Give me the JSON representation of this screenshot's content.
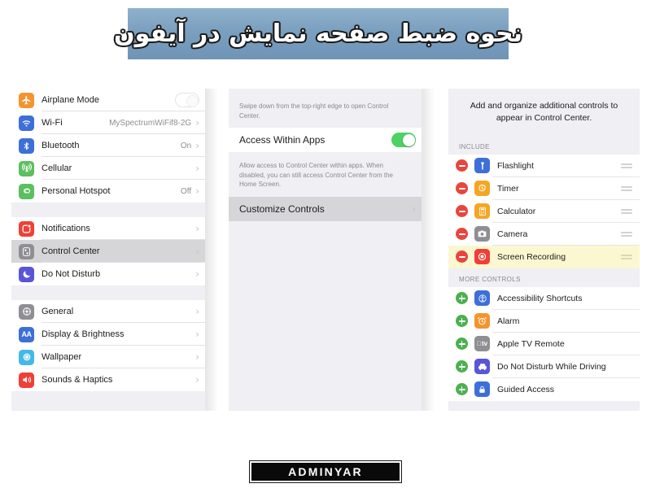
{
  "banner": {
    "title": "نحوه ضبط صفحه نمایش در آیفون",
    "bg_color": "#7a9fbf",
    "text_color": "#ffffff"
  },
  "settings_panel": {
    "groups": [
      {
        "rows": [
          {
            "label": "Airplane Mode",
            "value": "",
            "icon": "airplane-icon",
            "icon_color": "#f5942e",
            "accessory": "toggle",
            "toggle_state": "off"
          },
          {
            "label": "Wi-Fi",
            "value": "MySpectrumWiFif8-2G",
            "icon": "wifi-icon",
            "icon_color": "#3d6fd8",
            "accessory": "chevron"
          },
          {
            "label": "Bluetooth",
            "value": "On",
            "icon": "bluetooth-icon",
            "icon_color": "#3d6fd8",
            "accessory": "chevron"
          },
          {
            "label": "Cellular",
            "value": "",
            "icon": "cellular-icon",
            "icon_color": "#5bc05f",
            "accessory": "chevron"
          },
          {
            "label": "Personal Hotspot",
            "value": "Off",
            "icon": "hotspot-icon",
            "icon_color": "#5bc05f",
            "accessory": "chevron"
          }
        ]
      },
      {
        "rows": [
          {
            "label": "Notifications",
            "value": "",
            "icon": "notifications-icon",
            "icon_color": "#f03f36",
            "accessory": "chevron"
          },
          {
            "label": "Control Center",
            "value": "",
            "icon": "control-center-icon",
            "icon_color": "#8e8e93",
            "accessory": "chevron",
            "selected": true
          },
          {
            "label": "Do Not Disturb",
            "value": "",
            "icon": "moon-icon",
            "icon_color": "#5a55d8",
            "accessory": "chevron"
          }
        ]
      },
      {
        "rows": [
          {
            "label": "General",
            "value": "",
            "icon": "gear-icon",
            "icon_color": "#8e8e93",
            "accessory": "chevron"
          },
          {
            "label": "Display & Brightness",
            "value": "",
            "icon": "display-brightness-icon",
            "icon_color": "#3d6fd8",
            "accessory": "chevron"
          },
          {
            "label": "Wallpaper",
            "value": "",
            "icon": "wallpaper-icon",
            "icon_color": "#43b9e8",
            "accessory": "chevron"
          },
          {
            "label": "Sounds & Haptics",
            "value": "",
            "icon": "sounds-haptics-icon",
            "icon_color": "#f03f36",
            "accessory": "chevron"
          }
        ]
      }
    ]
  },
  "control_center_panel": {
    "top_note": "Swipe down from the top-right edge to open Control Center.",
    "access_within_apps": {
      "label": "Access Within Apps",
      "toggle_state": "on",
      "toggle_color": "#4cd364"
    },
    "access_note": "Allow access to Control Center within apps. When disabled, you can still access Control Center from the Home Screen.",
    "customize_controls": {
      "label": "Customize Controls",
      "accessory": "chevron",
      "selected": true
    }
  },
  "customize_panel": {
    "header_note": "Add and organize additional controls to appear in Control Center.",
    "include_header": "INCLUDE",
    "include_items": [
      {
        "label": "Flashlight",
        "icon": "flashlight-icon",
        "icon_color": "#3d6fd8",
        "action": "remove",
        "highlight": false
      },
      {
        "label": "Timer",
        "icon": "timer-icon",
        "icon_color": "#f5a623",
        "action": "remove",
        "highlight": false
      },
      {
        "label": "Calculator",
        "icon": "calculator-icon",
        "icon_color": "#f5a623",
        "action": "remove",
        "highlight": false
      },
      {
        "label": "Camera",
        "icon": "camera-icon",
        "icon_color": "#8e8e93",
        "action": "remove",
        "highlight": false
      },
      {
        "label": "Screen Recording",
        "icon": "screen-recording-icon",
        "icon_color": "#f03f36",
        "action": "remove",
        "highlight": true
      }
    ],
    "more_controls_header": "MORE CONTROLS",
    "more_items": [
      {
        "label": "Accessibility Shortcuts",
        "icon": "accessibility-icon",
        "icon_color": "#3d6fd8",
        "action": "add"
      },
      {
        "label": "Alarm",
        "icon": "alarm-icon",
        "icon_color": "#f5942e",
        "action": "add"
      },
      {
        "label": "Apple TV Remote",
        "icon": "apple-tv-remote-icon",
        "icon_color": "#8e8e93",
        "action": "add"
      },
      {
        "label": "Do Not Disturb While Driving",
        "icon": "car-icon",
        "icon_color": "#5a55d8",
        "action": "add"
      },
      {
        "label": "Guided Access",
        "icon": "guided-access-icon",
        "icon_color": "#3d6fd8",
        "action": "add"
      }
    ],
    "highlight_color": "#fbf7d0",
    "remove_badge_color": "#e8453c",
    "add_badge_color": "#4cb050"
  },
  "footer": {
    "logo_text": "ADMINYAR",
    "logo_bg": "#0a0a0a",
    "logo_fg": "#ffffff"
  }
}
